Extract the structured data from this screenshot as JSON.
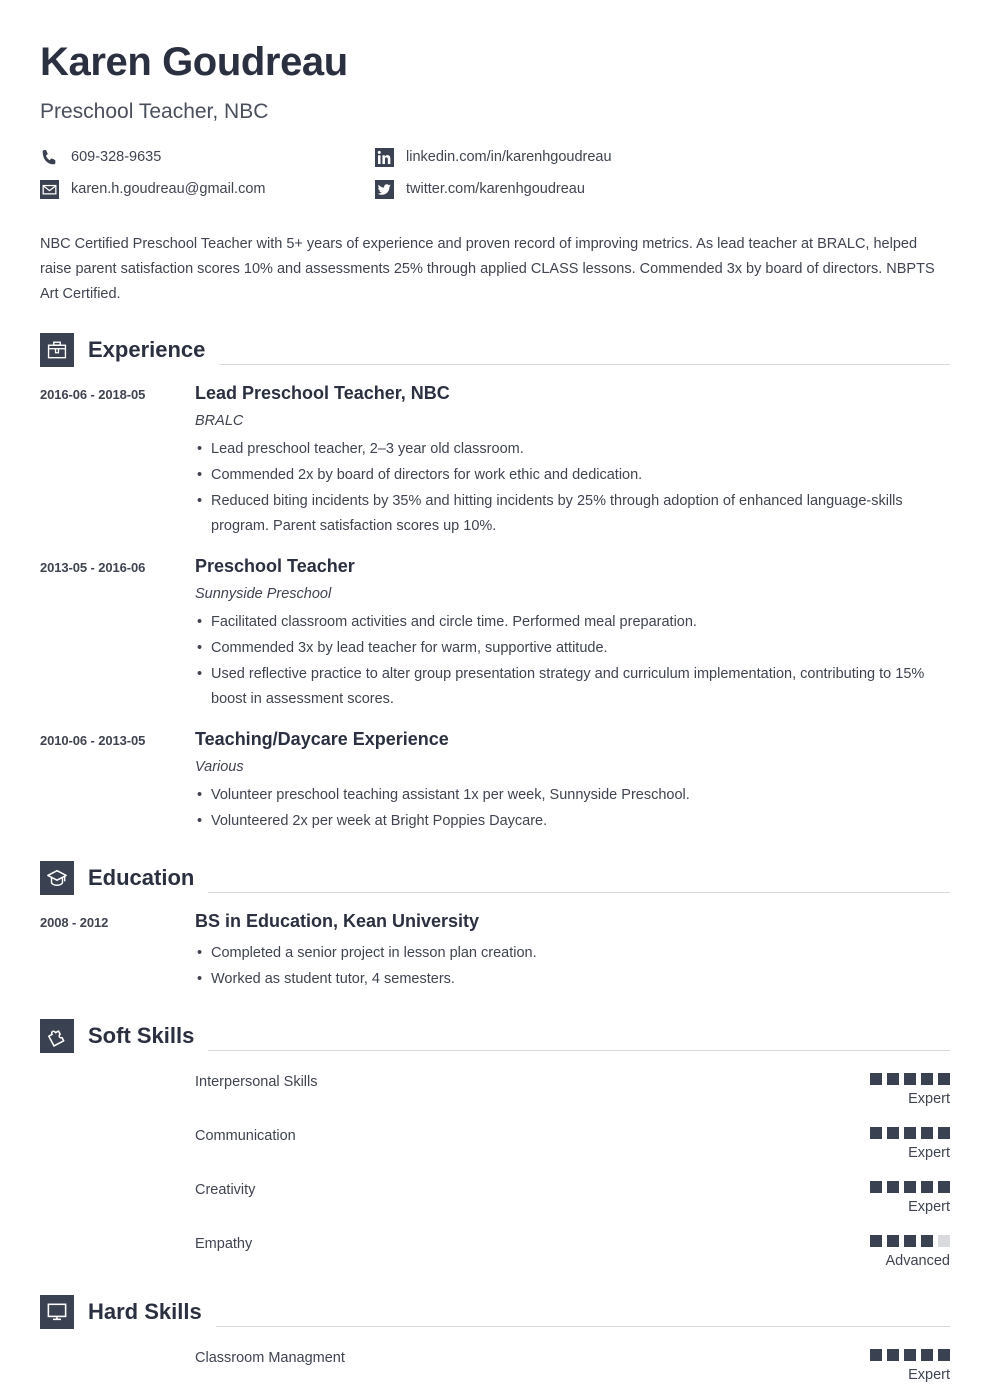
{
  "header": {
    "name": "Karen Goudreau",
    "job_title": "Preschool Teacher, NBC",
    "contacts": [
      {
        "icon": "phone-icon",
        "text": "609-328-9635"
      },
      {
        "icon": "linkedin-icon",
        "text": "linkedin.com/in/karenhgoudreau"
      },
      {
        "icon": "email-icon",
        "text": "karen.h.goudreau@gmail.com"
      },
      {
        "icon": "twitter-icon",
        "text": "twitter.com/karenhgoudreau"
      }
    ]
  },
  "summary": "NBC Certified Preschool Teacher with 5+ years of experience and proven record of improving metrics. As lead teacher at BRALC, helped raise parent satisfaction scores 10% and assessments 25% through applied CLASS lessons. Commended 3x by board of directors. NBPTS Art Certified.",
  "sections": {
    "experience": {
      "title": "Experience",
      "icon": "briefcase-icon",
      "entries": [
        {
          "date": "2016-06 - 2018-05",
          "title": "Lead Preschool Teacher, NBC",
          "org": "BRALC",
          "bullets": [
            "Lead preschool teacher, 2–3 year old classroom.",
            "Commended 2x by board of directors for work ethic and dedication.",
            "Reduced biting incidents by 35% and hitting incidents by 25% through adoption of enhanced language-skills program. Parent satisfaction scores up 10%."
          ]
        },
        {
          "date": "2013-05 - 2016-06",
          "title": "Preschool Teacher",
          "org": "Sunnyside Preschool",
          "bullets": [
            "Facilitated classroom activities and circle time. Performed meal preparation.",
            "Commended 3x by lead teacher for warm, supportive attitude.",
            "Used reflective practice to alter group presentation strategy and curriculum implementation, contributing to 15% boost in assessment scores."
          ]
        },
        {
          "date": "2010-06 - 2013-05",
          "title": "Teaching/Daycare Experience",
          "org": "Various",
          "bullets": [
            "Volunteer preschool teaching assistant 1x per week, Sunnyside Preschool.",
            "Volunteered 2x per week at Bright Poppies Daycare."
          ]
        }
      ]
    },
    "education": {
      "title": "Education",
      "icon": "graduation-cap-icon",
      "entries": [
        {
          "date": "2008 - 2012",
          "title": "BS in Education, Kean University",
          "org": "",
          "bullets": [
            "Completed a senior project in lesson plan creation.",
            "Worked as student tutor, 4 semesters."
          ]
        }
      ]
    },
    "soft_skills": {
      "title": "Soft Skills",
      "icon": "puzzle-piece-icon",
      "max_rating": 5,
      "skills": [
        {
          "name": "Interpersonal Skills",
          "rating": 5,
          "level": "Expert"
        },
        {
          "name": "Communication",
          "rating": 5,
          "level": "Expert"
        },
        {
          "name": "Creativity",
          "rating": 5,
          "level": "Expert"
        },
        {
          "name": "Empathy",
          "rating": 4,
          "level": "Advanced"
        }
      ]
    },
    "hard_skills": {
      "title": "Hard Skills",
      "icon": "monitor-icon",
      "max_rating": 5,
      "skills": [
        {
          "name": "Classroom Managment",
          "rating": 5,
          "level": "Expert"
        }
      ]
    }
  },
  "colors": {
    "accent_dark": "#3a4150",
    "heading": "#2b3040",
    "body_text": "#3f4450",
    "rule": "#d8dade",
    "square_off": "#d9dade"
  }
}
